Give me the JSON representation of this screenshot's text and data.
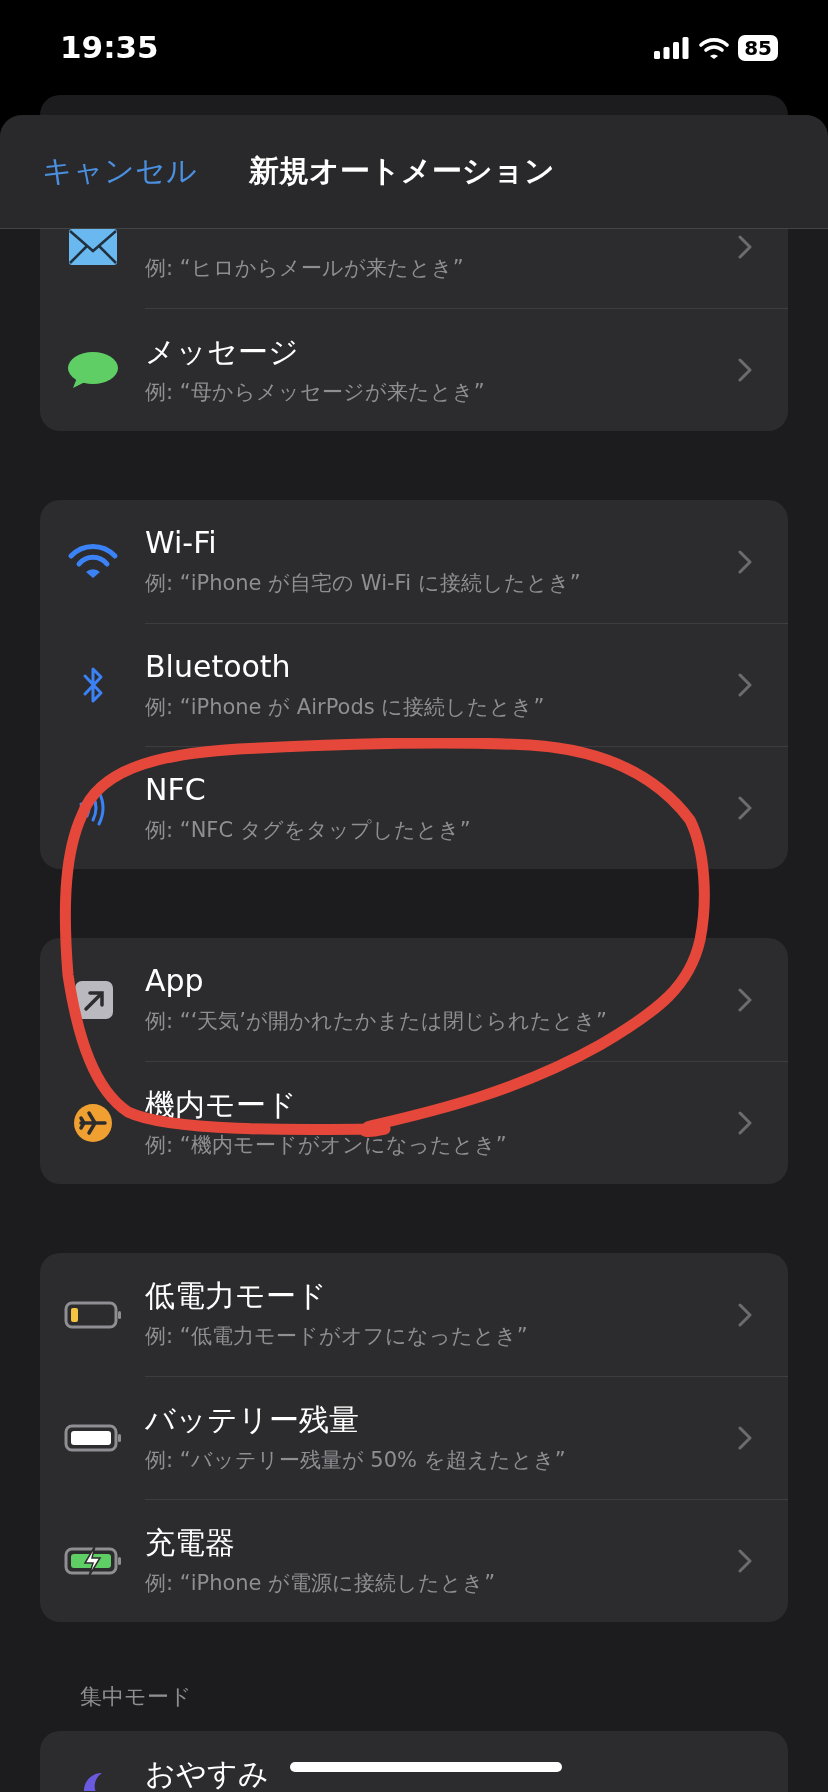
{
  "status_bar": {
    "time": "19:35",
    "battery": "85"
  },
  "header": {
    "cancel": "キャンセル",
    "title": "新規オートメーション"
  },
  "groups": [
    {
      "rows": [
        {
          "kind": "mail",
          "subtitle": "例: “ヒロからメールが来たとき”"
        },
        {
          "kind": "message",
          "title": "メッセージ",
          "subtitle": "例: “母からメッセージが来たとき”"
        }
      ]
    },
    {
      "rows": [
        {
          "kind": "wifi",
          "title": "Wi-Fi",
          "subtitle": "例: “iPhone が自宅の Wi-Fi に接続したとき”"
        },
        {
          "kind": "bluetooth",
          "title": "Bluetooth",
          "subtitle": "例: “iPhone が AirPods に接続したとき”"
        },
        {
          "kind": "nfc",
          "title": "NFC",
          "subtitle": "例: “NFC タグをタップしたとき”"
        }
      ]
    },
    {
      "rows": [
        {
          "kind": "app",
          "title": "App",
          "subtitle": "例: “‘天気’が開かれたかまたは閉じられたとき”"
        },
        {
          "kind": "airplane",
          "title": "機内モード",
          "subtitle": "例: “機内モードがオンになったとき”"
        }
      ]
    },
    {
      "rows": [
        {
          "kind": "battery-low",
          "title": "低電力モード",
          "subtitle": "例: “低電力モードがオフになったとき”"
        },
        {
          "kind": "battery-full",
          "title": "バッテリー残量",
          "subtitle": "例: “バッテリー残量が 50% を超えたとき”"
        },
        {
          "kind": "battery-charging",
          "title": "充電器",
          "subtitle": "例: “iPhone が電源に接続したとき”"
        }
      ]
    }
  ],
  "section": {
    "title": "集中モード",
    "rows": [
      {
        "kind": "moon",
        "title": "おやすみ"
      }
    ]
  }
}
